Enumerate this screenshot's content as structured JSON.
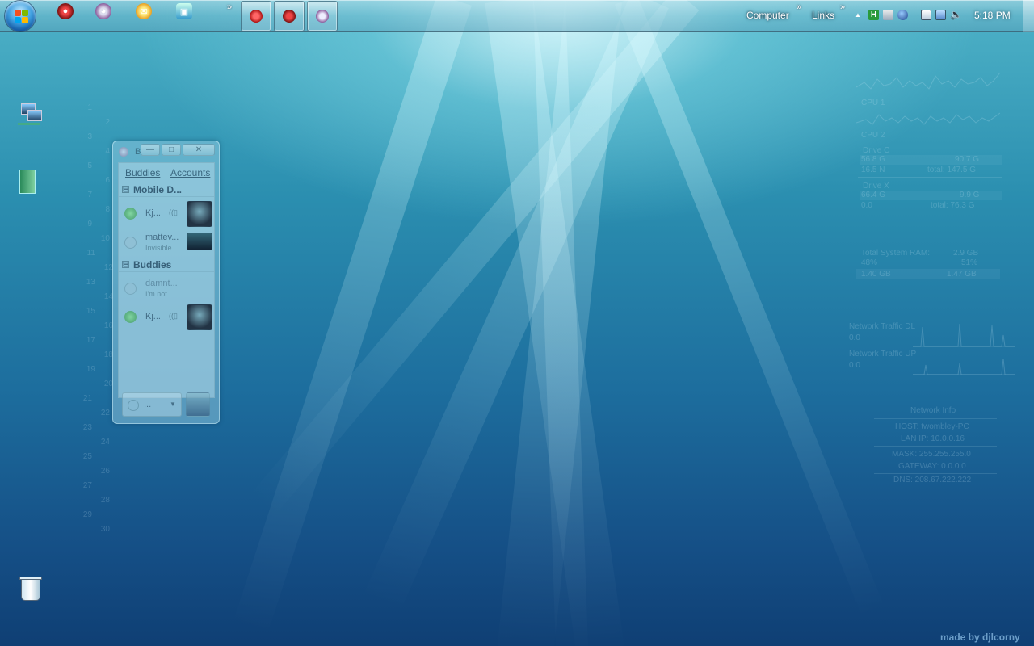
{
  "taskbar": {
    "computer_label": "Computer",
    "links_label": "Links",
    "chevron": "»",
    "tray_up": "▲",
    "clock": "5:18 PM",
    "icons": [
      "start-orb",
      "quicklaunch-1",
      "quicklaunch-2",
      "quicklaunch-3",
      "quicklaunch-4"
    ]
  },
  "calendar": {
    "days": [
      "1",
      "2",
      "3",
      "4",
      "5",
      "6",
      "7",
      "8",
      "9",
      "10",
      "11",
      "12",
      "13",
      "14",
      "15",
      "16",
      "17",
      "18",
      "19",
      "20",
      "21",
      "22",
      "23",
      "24",
      "25",
      "26",
      "27",
      "28",
      "29",
      "30"
    ]
  },
  "buddy_window": {
    "title": "B",
    "menu": {
      "buddies": "Buddies",
      "accounts": "Accounts"
    },
    "groups": [
      {
        "name": "Mobile D...",
        "buddies": [
          {
            "name": "Kj...",
            "sub": ""
          },
          {
            "name": "mattev...",
            "sub": "Invisible"
          }
        ]
      },
      {
        "name": "Buddies",
        "buddies": [
          {
            "name": "damnt...",
            "sub": "I'm not ..."
          },
          {
            "name": "Kj...",
            "sub": ""
          }
        ]
      }
    ],
    "status_text": "...",
    "collapse_glyph": "⊟",
    "dropdown_glyph": "▼"
  },
  "monitor": {
    "cpu1": "CPU 1",
    "cpu2": "CPU 2",
    "drive_c": {
      "label": "Drive C",
      "used": "56.8 G",
      "size": "90.7 G",
      "free": "16.5 N",
      "total": "total: 147.5 G"
    },
    "drive_x": {
      "label": "Drive X",
      "used": "66.4 G",
      "size": "9.9 G",
      "free": "0.0",
      "total": "total: 76.3 G"
    },
    "ram": {
      "label": "Total System RAM:",
      "total": "2.9 GB",
      "pct_used": "48%",
      "pct_free": "51%",
      "used": "1.40 GB",
      "free": "1.47 GB"
    },
    "net_dl": {
      "label": "Network Traffic DL",
      "value": "0.0"
    },
    "net_ul": {
      "label": "Network Traffic UP",
      "value": "0.0"
    },
    "net_info": {
      "title": "Network Info",
      "host": "HOST: twombley-PC",
      "lan": "LAN IP: 10.0.0.16",
      "mask": "MASK: 255.255.255.0",
      "gateway": "GATEWAY: 0.0.0.0",
      "dns": "DNS: 208.67.222.222"
    }
  },
  "credit": "made by djlcorny",
  "colors": {
    "status_online": "#3aa05a",
    "accent": "#1d6e9e"
  }
}
